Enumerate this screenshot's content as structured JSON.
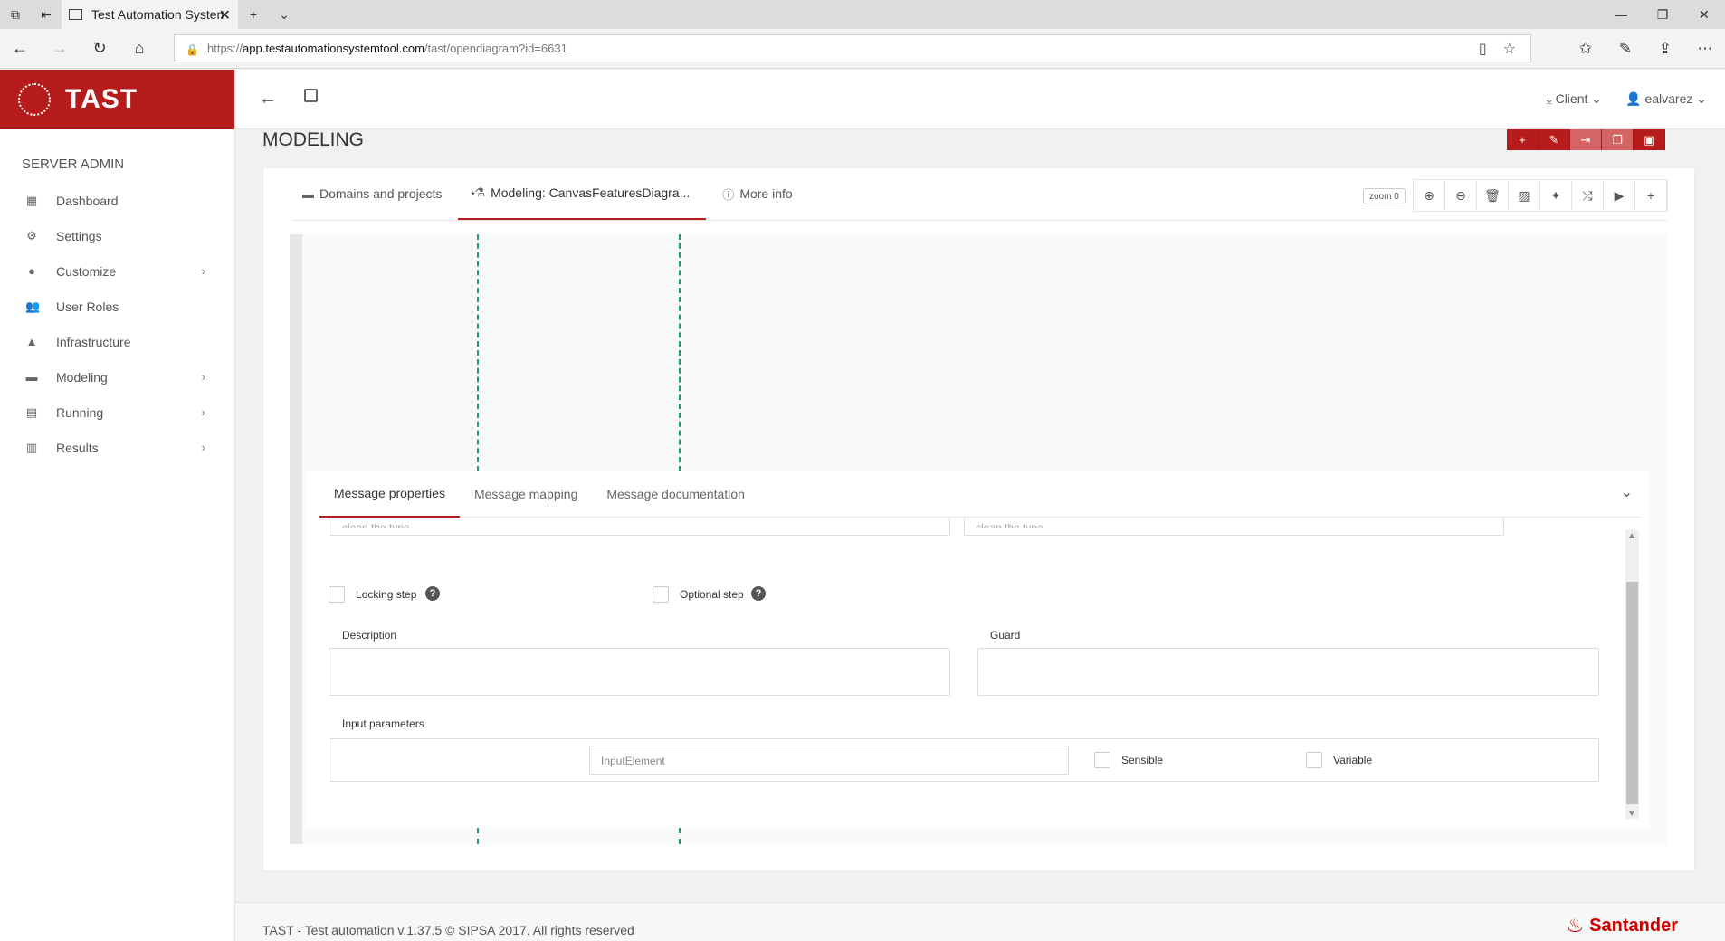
{
  "browser": {
    "tab_title": "Test Automation Systen",
    "url_prefix": "https://",
    "url_host": "app.testautomationsystemtool.com",
    "url_path": "/tast/opendiagram?id=6631"
  },
  "sidebar": {
    "brand": "TAST",
    "section_title": "SERVER ADMIN",
    "items": [
      {
        "label": "Dashboard",
        "icon": "dashboard-icon",
        "has_children": false
      },
      {
        "label": "Settings",
        "icon": "gear-icon",
        "has_children": false
      },
      {
        "label": "Customize",
        "icon": "circle-icon",
        "has_children": true
      },
      {
        "label": "User Roles",
        "icon": "users-icon",
        "has_children": false
      },
      {
        "label": "Infrastructure",
        "icon": "road-icon",
        "has_children": false
      },
      {
        "label": "Modeling",
        "icon": "briefcase-icon",
        "has_children": true
      },
      {
        "label": "Running",
        "icon": "calendar-icon",
        "has_children": true
      },
      {
        "label": "Results",
        "icon": "bar-chart-icon",
        "has_children": true
      }
    ]
  },
  "header": {
    "client_label": "Client",
    "user_label": "ealvarez"
  },
  "page": {
    "title": "MODELING"
  },
  "tabs": {
    "domains": "Domains and projects",
    "modeling_star": "*",
    "modeling": "Modeling: CanvasFeaturesDiagra...",
    "more_info": "More info"
  },
  "toolbar": {
    "zoom_label": "zoom 0"
  },
  "props": {
    "tabs": [
      "Message properties",
      "Message mapping",
      "Message documentation"
    ],
    "placeholder_left": "clean the type",
    "placeholder_right": "clean the type",
    "locking_step": "Locking step",
    "optional_step": "Optional step",
    "description_label": "Description",
    "guard_label": "Guard",
    "input_params_label": "Input parameters",
    "input_element_placeholder": "InputElement",
    "sensible_label": "Sensible",
    "variable_label": "Variable"
  },
  "footer": {
    "copyright": "TAST - Test automation v.1.37.5 © SIPSA 2017. All rights reserved",
    "brand": "Santander"
  }
}
